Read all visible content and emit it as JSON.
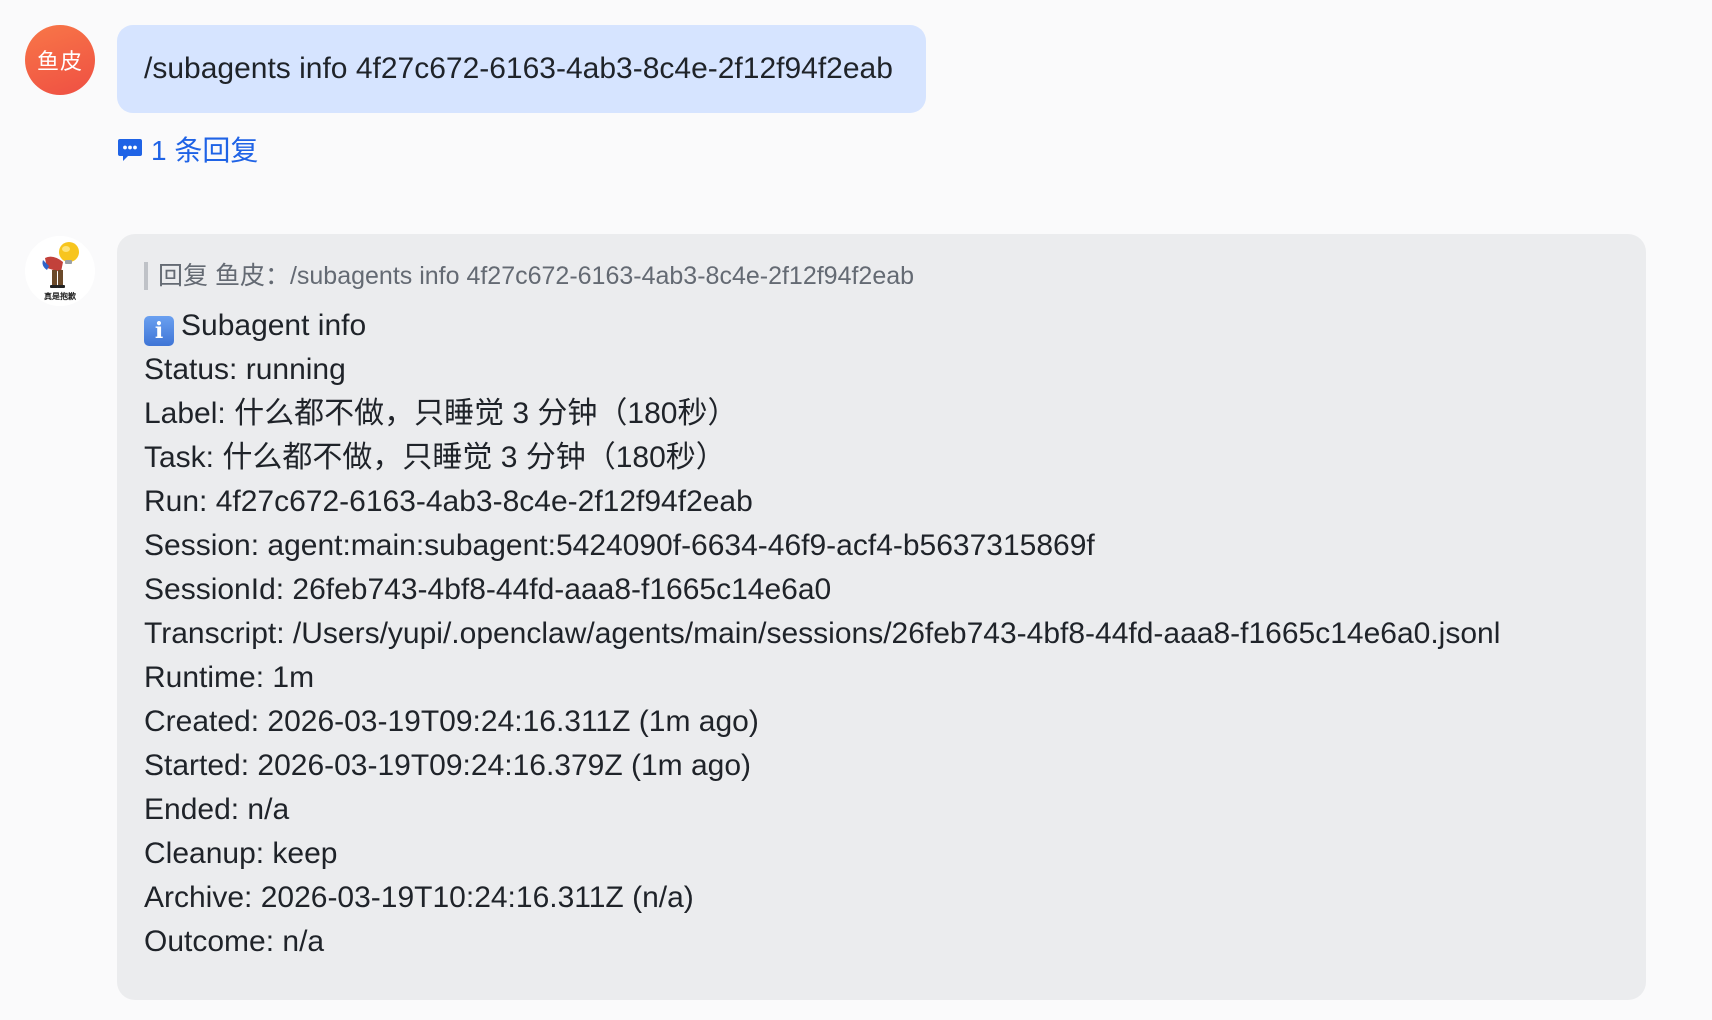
{
  "messages": {
    "user": {
      "avatar_text": "鱼皮",
      "text": "/subagents info 4f27c672-6163-4ab3-8c4e-2f12f94f2eab",
      "reply_count_label": "1 条回复"
    },
    "bot": {
      "avatar_icon": "character-avatar-icon",
      "avatar_caption": "真是抱歉",
      "quote_text": "回复 鱼皮：/subagents info 4f27c672-6163-4ab3-8c4e-2f12f94f2eab",
      "title": "Subagent info",
      "title_icon": "info-icon",
      "lines": [
        "Status: running",
        "Label: 什么都不做，只睡觉 3 分钟（180秒）",
        "Task: 什么都不做，只睡觉 3 分钟（180秒）",
        "Run: 4f27c672-6163-4ab3-8c4e-2f12f94f2eab",
        "Session: agent:main:subagent:5424090f-6634-46f9-acf4-b5637315869f",
        "SessionId: 26feb743-4bf8-44fd-aaa8-f1665c14e6a0",
        "Transcript: /Users/yupi/.openclaw/agents/main/sessions/26feb743-4bf8-44fd-aaa8-f1665c14e6a0.jsonl",
        "Runtime: 1m",
        "Created: 2026-03-19T09:24:16.311Z (1m ago)",
        "Started: 2026-03-19T09:24:16.379Z (1m ago)",
        "Ended: n/a",
        "Cleanup: keep",
        "Archive: 2026-03-19T10:24:16.311Z (n/a)",
        "Outcome: n/a"
      ]
    }
  },
  "colors": {
    "page_background": "#fafafb",
    "user_bubble": "#d6e4ff",
    "bot_bubble": "#ebecee",
    "link": "#1f63e6",
    "avatar_gradient_start": "#f87748",
    "avatar_gradient_end": "#ef4f43"
  }
}
